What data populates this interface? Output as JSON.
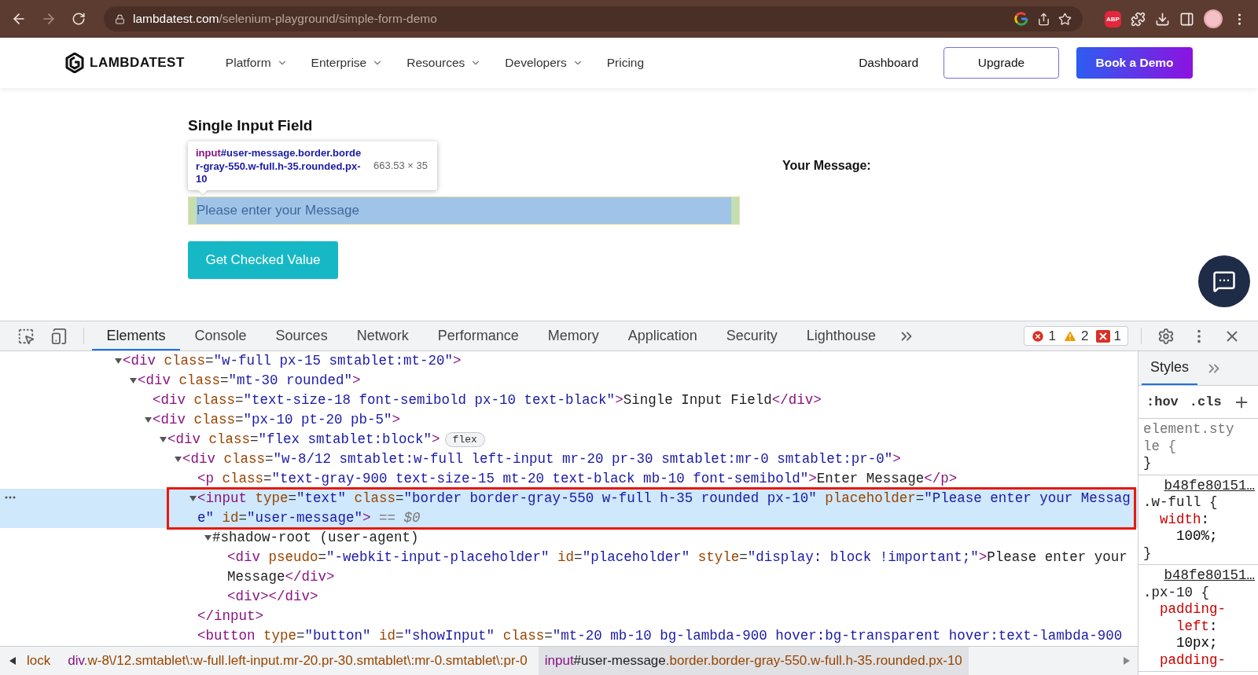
{
  "browser": {
    "url_domain": "lambdatest.com",
    "url_path": "/selenium-playground/simple-form-demo",
    "extension_badge": "ABP"
  },
  "site_nav": {
    "logo": "LAMBDATEST",
    "items": [
      {
        "label": "Platform",
        "has_menu": true
      },
      {
        "label": "Enterprise",
        "has_menu": true
      },
      {
        "label": "Resources",
        "has_menu": true
      },
      {
        "label": "Developers",
        "has_menu": true
      },
      {
        "label": "Pricing",
        "has_menu": false
      }
    ],
    "actions": [
      {
        "label": "Dashboard",
        "kind": "link"
      },
      {
        "label": "Upgrade",
        "kind": "outline"
      },
      {
        "label": "Book a Demo",
        "kind": "primary"
      }
    ]
  },
  "page": {
    "title": "Single Input Field",
    "inspect_tooltip": {
      "tag": "input",
      "selector": "#user-message.border.border-gray-550.w-full.h-35.rounded.px-10",
      "size": "663.53 × 35"
    },
    "message_input": {
      "placeholder": "Please enter your Message",
      "inspected": true
    },
    "submit_button": "Get Checked Value",
    "result_label": "Your Message:"
  },
  "devtools": {
    "tabs": [
      {
        "label": "Elements",
        "selected": true
      },
      {
        "label": "Console",
        "selected": false
      },
      {
        "label": "Sources",
        "selected": false
      },
      {
        "label": "Network",
        "selected": false
      },
      {
        "label": "Performance",
        "selected": false
      },
      {
        "label": "Memory",
        "selected": false
      },
      {
        "label": "Application",
        "selected": false
      },
      {
        "label": "Security",
        "selected": false
      },
      {
        "label": "Lighthouse",
        "selected": false
      }
    ],
    "counters": [
      {
        "kind": "error",
        "count": "1"
      },
      {
        "kind": "warning",
        "count": "2"
      },
      {
        "kind": "issue",
        "count": "1"
      }
    ],
    "dom_tree": [
      {
        "tokens": [
          {
            "kind": "tag",
            "text": "<div"
          },
          {
            "kind": "attr",
            "text": " class"
          },
          {
            "kind": "punct",
            "text": "="
          },
          {
            "kind": "value",
            "text": "\"w-full px-15 smtablet:mt-20\""
          },
          {
            "kind": "tag",
            "text": ">"
          }
        ],
        "expanded": true,
        "selected": false,
        "children": [
          {
            "tokens": [
              {
                "kind": "tag",
                "text": "<div"
              },
              {
                "kind": "attr",
                "text": " class"
              },
              {
                "kind": "punct",
                "text": "="
              },
              {
                "kind": "value",
                "text": "\"mt-30 rounded\""
              },
              {
                "kind": "tag",
                "text": ">"
              }
            ],
            "expanded": true,
            "selected": false,
            "children": [
              {
                "tokens": [
                  {
                    "kind": "tag",
                    "text": "<div"
                  },
                  {
                    "kind": "attr",
                    "text": " class"
                  },
                  {
                    "kind": "punct",
                    "text": "="
                  },
                  {
                    "kind": "value",
                    "text": "\"text-size-18 font-semibold px-10 text-black\""
                  },
                  {
                    "kind": "tag",
                    "text": ">"
                  },
                  {
                    "kind": "text",
                    "text": "Single Input Field"
                  },
                  {
                    "kind": "tag",
                    "text": "</div>"
                  }
                ],
                "selected": false
              },
              {
                "tokens": [
                  {
                    "kind": "tag",
                    "text": "<div"
                  },
                  {
                    "kind": "attr",
                    "text": " class"
                  },
                  {
                    "kind": "punct",
                    "text": "="
                  },
                  {
                    "kind": "value",
                    "text": "\"px-10 pt-20 pb-5\""
                  },
                  {
                    "kind": "tag",
                    "text": ">"
                  }
                ],
                "expanded": true,
                "selected": false,
                "children": [
                  {
                    "tokens": [
                      {
                        "kind": "tag",
                        "text": "<div"
                      },
                      {
                        "kind": "attr",
                        "text": " class"
                      },
                      {
                        "kind": "punct",
                        "text": "="
                      },
                      {
                        "kind": "value",
                        "text": "\"flex smtablet:block\""
                      },
                      {
                        "kind": "tag",
                        "text": ">"
                      }
                    ],
                    "badge": "flex",
                    "expanded": true,
                    "selected": false,
                    "children": [
                      {
                        "tokens": [
                          {
                            "kind": "tag",
                            "text": "<div"
                          },
                          {
                            "kind": "attr",
                            "text": " class"
                          },
                          {
                            "kind": "punct",
                            "text": "="
                          },
                          {
                            "kind": "value",
                            "text": "\"w-8/12 smtablet:w-full left-input mr-20 pr-30 smtablet:mr-0 smtablet:pr-0\""
                          },
                          {
                            "kind": "tag",
                            "text": ">"
                          }
                        ],
                        "expanded": true,
                        "selected": false,
                        "children": [
                          {
                            "tokens": [
                              {
                                "kind": "tag",
                                "text": "<p"
                              },
                              {
                                "kind": "attr",
                                "text": " class"
                              },
                              {
                                "kind": "punct",
                                "text": "="
                              },
                              {
                                "kind": "value",
                                "text": "\"text-gray-900 text-size-15 mt-20 text-black mb-10 font-semibold\""
                              },
                              {
                                "kind": "tag",
                                "text": ">"
                              },
                              {
                                "kind": "text",
                                "text": "Enter Message"
                              },
                              {
                                "kind": "tag",
                                "text": "</p>"
                              }
                            ],
                            "selected": false
                          },
                          {
                            "tokens": [
                              {
                                "kind": "tag",
                                "text": "<input"
                              },
                              {
                                "kind": "attr",
                                "text": " type"
                              },
                              {
                                "kind": "punct",
                                "text": "="
                              },
                              {
                                "kind": "value",
                                "text": "\"text\""
                              },
                              {
                                "kind": "attr",
                                "text": " class"
                              },
                              {
                                "kind": "punct",
                                "text": "="
                              },
                              {
                                "kind": "value",
                                "text": "\"border border-gray-550 w-full h-35 rounded px-10\""
                              },
                              {
                                "kind": "attr",
                                "text": " placeholder"
                              },
                              {
                                "kind": "punct",
                                "text": "="
                              },
                              {
                                "kind": "value",
                                "text": "\"Please enter your Message\""
                              },
                              {
                                "kind": "attr",
                                "text": " id"
                              },
                              {
                                "kind": "punct",
                                "text": "="
                              },
                              {
                                "kind": "value",
                                "text": "\"user-message\""
                              },
                              {
                                "kind": "tag",
                                "text": ">"
                              },
                              {
                                "kind": "hint",
                                "text": " == $0"
                              }
                            ],
                            "expanded": true,
                            "selected": true,
                            "highlighted": true,
                            "closing": [
                              {
                                "kind": "tag",
                                "text": "</input>"
                              }
                            ],
                            "children": [
                              {
                                "tokens": [
                                  {
                                    "kind": "text",
                                    "text": "#shadow-root (user-agent)"
                                  }
                                ],
                                "expanded": true,
                                "selected": false,
                                "children": [
                                  {
                                    "tokens": [
                                      {
                                        "kind": "tag",
                                        "text": "<div"
                                      },
                                      {
                                        "kind": "attr",
                                        "text": " pseudo"
                                      },
                                      {
                                        "kind": "punct",
                                        "text": "="
                                      },
                                      {
                                        "kind": "value",
                                        "text": "\"-webkit-input-placeholder\""
                                      },
                                      {
                                        "kind": "attr",
                                        "text": " id"
                                      },
                                      {
                                        "kind": "punct",
                                        "text": "="
                                      },
                                      {
                                        "kind": "value",
                                        "text": "\"placeholder\""
                                      },
                                      {
                                        "kind": "attr",
                                        "text": " style"
                                      },
                                      {
                                        "kind": "punct",
                                        "text": "="
                                      },
                                      {
                                        "kind": "value",
                                        "text": "\"display: block !important;\""
                                      },
                                      {
                                        "kind": "tag",
                                        "text": ">"
                                      },
                                      {
                                        "kind": "text",
                                        "text": "Please enter your Message"
                                      },
                                      {
                                        "kind": "tag",
                                        "text": "</div>"
                                      }
                                    ],
                                    "selected": false
                                  },
                                  {
                                    "tokens": [
                                      {
                                        "kind": "tag",
                                        "text": "<div>"
                                      },
                                      {
                                        "kind": "tag",
                                        "text": "</div>"
                                      }
                                    ],
                                    "selected": false
                                  }
                                ]
                              }
                            ]
                          },
                          {
                            "tokens": [
                              {
                                "kind": "tag",
                                "text": "<button"
                              },
                              {
                                "kind": "attr",
                                "text": " type"
                              },
                              {
                                "kind": "punct",
                                "text": "="
                              },
                              {
                                "kind": "value",
                                "text": "\"button\""
                              },
                              {
                                "kind": "attr",
                                "text": " id"
                              },
                              {
                                "kind": "punct",
                                "text": "="
                              },
                              {
                                "kind": "value",
                                "text": "\"showInput\""
                              },
                              {
                                "kind": "attr",
                                "text": " class"
                              },
                              {
                                "kind": "punct",
                                "text": "="
                              },
                              {
                                "kind": "value",
                                "text": "\"mt-20 mb-10 bg-lambda-900 hover:bg-transparent hover:text-lambda-900"
                              }
                            ],
                            "selected": false
                          }
                        ]
                      }
                    ]
                  }
                ]
              }
            ]
          }
        ]
      }
    ],
    "breadcrumbs": [
      {
        "tokens": [
          {
            "kind": "attr",
            "text": "lock"
          }
        ],
        "selected": false
      },
      {
        "tokens": [
          {
            "kind": "tag",
            "text": "div"
          },
          {
            "kind": "attr",
            "text": ".w-8\\/12.smtablet\\:w-full.left-input.mr-20.pr-30.smtablet\\:mr-0.smtablet\\:pr-0"
          }
        ],
        "selected": false
      },
      {
        "tokens": [
          {
            "kind": "tag",
            "text": "input"
          },
          {
            "kind": "text",
            "text": "#user-message"
          },
          {
            "kind": "attr",
            "text": ".border.border-gray-550.w-full.h-35.rounded.px-10"
          }
        ],
        "selected": true
      }
    ],
    "styles_panel": {
      "tabs": [
        {
          "label": "Styles",
          "selected": true
        }
      ],
      "filter_buttons": [
        ":hov",
        ".cls"
      ],
      "rules": [
        {
          "kind": "inline",
          "selector": "element.style {",
          "close": "}"
        },
        {
          "kind": "stylesheet",
          "source": "b48fe80151…",
          "selector": ".w-full {",
          "declarations": [
            {
              "name": "width",
              "value": ": 100%;"
            }
          ],
          "close": "}"
        },
        {
          "kind": "stylesheet",
          "source": "b48fe80151…",
          "selector": ".px-10 {",
          "declarations": [
            {
              "name": "padding-left",
              "value": ": 10px;"
            },
            {
              "name": "padding-"
            }
          ]
        }
      ]
    }
  }
}
